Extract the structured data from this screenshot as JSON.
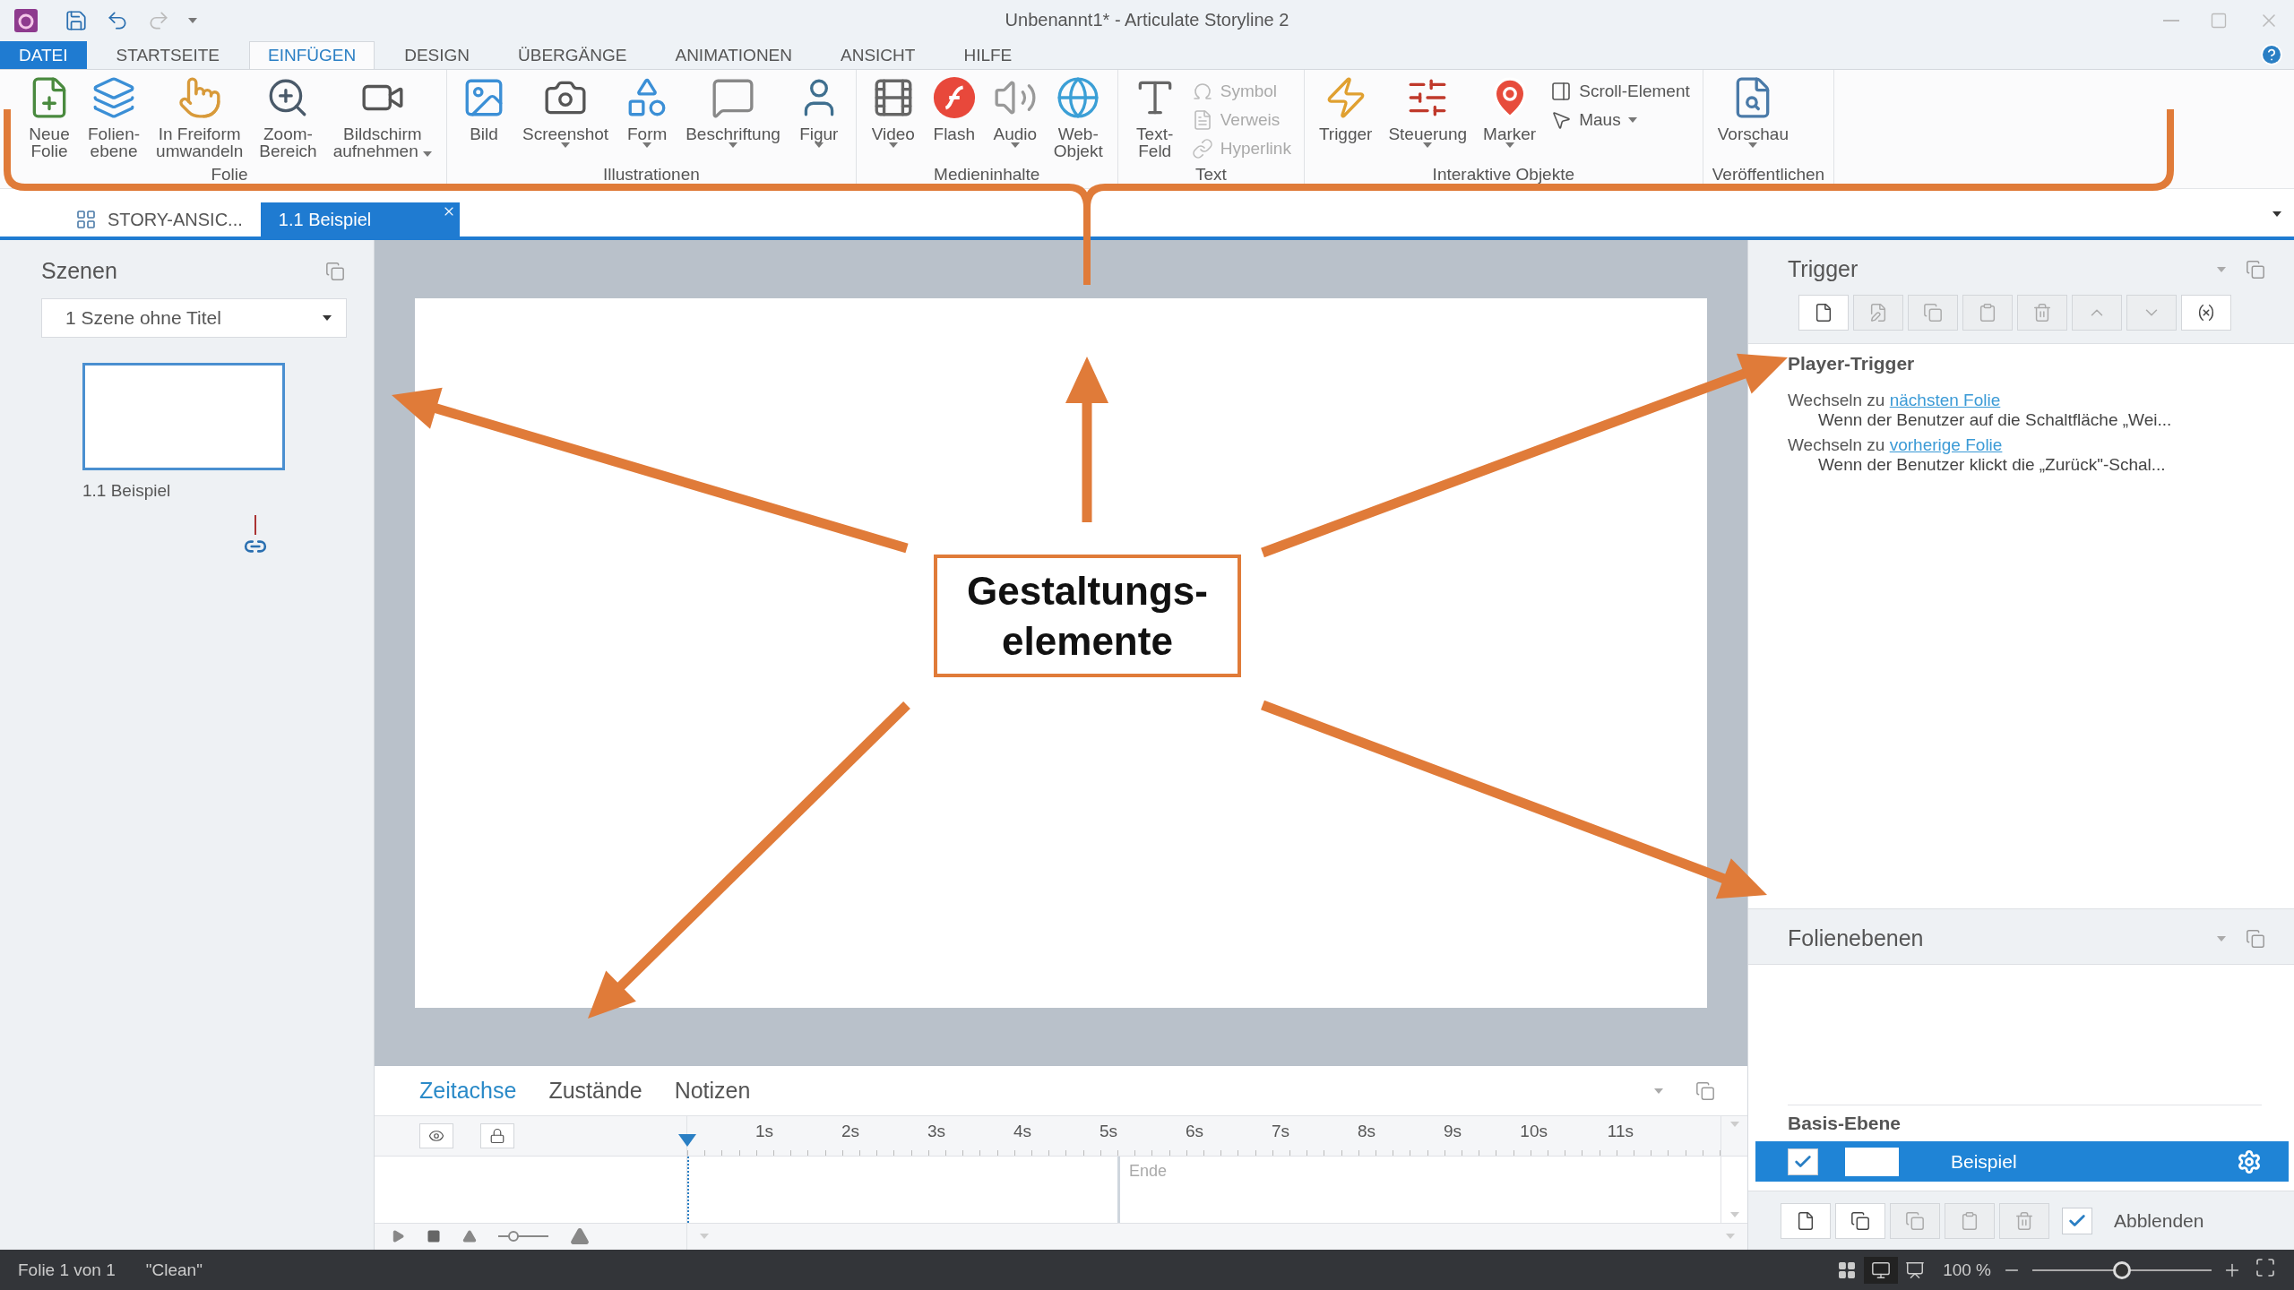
{
  "window": {
    "title": "Unbenannt1* - Articulate Storyline 2"
  },
  "ribbon_tabs": [
    {
      "label": "DATEI",
      "kind": "file",
      "selected": false
    },
    {
      "label": "STARTSEITE",
      "kind": "tab",
      "selected": false
    },
    {
      "label": "EINFÜGEN",
      "kind": "tab",
      "selected": true
    },
    {
      "label": "DESIGN",
      "kind": "tab",
      "selected": false
    },
    {
      "label": "ÜBERGÄNGE",
      "kind": "tab",
      "selected": false
    },
    {
      "label": "ANIMATIONEN",
      "kind": "tab",
      "selected": false
    },
    {
      "label": "ANSICHT",
      "kind": "tab",
      "selected": false
    },
    {
      "label": "HILFE",
      "kind": "tab",
      "selected": false
    }
  ],
  "ribbon_groups": [
    {
      "label": "Folie",
      "items": [
        {
          "kind": "large",
          "label": "Neue\nFolie",
          "dropdown": false
        },
        {
          "kind": "large",
          "label": "Folien-\nebene",
          "dropdown": false
        },
        {
          "kind": "large",
          "label": "In Freiform\numwandeln",
          "dropdown": false
        },
        {
          "kind": "large",
          "label": "Zoom-\nBereich",
          "dropdown": false
        },
        {
          "kind": "large",
          "label": "Bildschirm\naufnehmen",
          "dropdown": true,
          "inline_caret": true
        }
      ]
    },
    {
      "label": "Illustrationen",
      "items": [
        {
          "kind": "large",
          "label": "Bild",
          "dropdown": false
        },
        {
          "kind": "large",
          "label": "Screenshot",
          "dropdown": true
        },
        {
          "kind": "large",
          "label": "Form",
          "dropdown": true
        },
        {
          "kind": "large",
          "label": "Beschriftung",
          "dropdown": true
        },
        {
          "kind": "large",
          "label": "Figur",
          "dropdown": true
        }
      ]
    },
    {
      "label": "Medieninhalte",
      "items": [
        {
          "kind": "large",
          "label": "Video",
          "dropdown": true
        },
        {
          "kind": "large",
          "label": "Flash",
          "dropdown": false
        },
        {
          "kind": "large",
          "label": "Audio",
          "dropdown": true
        },
        {
          "kind": "large",
          "label": "Web-\nObjekt",
          "dropdown": false
        }
      ]
    },
    {
      "label": "Text",
      "items": [
        {
          "kind": "large",
          "label": "Text-\nFeld",
          "dropdown": false
        },
        {
          "kind": "small",
          "label": "Symbol",
          "disabled": true
        },
        {
          "kind": "small",
          "label": "Verweis",
          "disabled": true
        },
        {
          "kind": "small",
          "label": "Hyperlink",
          "disabled": true
        }
      ]
    },
    {
      "label": "Interaktive Objekte",
      "items": [
        {
          "kind": "large",
          "label": "Trigger",
          "dropdown": false
        },
        {
          "kind": "large",
          "label": "Steuerung",
          "dropdown": true
        },
        {
          "kind": "large",
          "label": "Marker",
          "dropdown": true
        },
        {
          "kind": "small",
          "label": "Scroll-Element",
          "disabled": false,
          "dropdown": false
        },
        {
          "kind": "small",
          "label": "Maus",
          "disabled": false,
          "dropdown": true
        }
      ]
    },
    {
      "label": "Veröffentlichen",
      "items": [
        {
          "kind": "large",
          "label": "Vorschau",
          "dropdown": true
        }
      ]
    }
  ],
  "doc_tabs": [
    {
      "label": "STORY-ANSIC...",
      "selected": false,
      "closable": false
    },
    {
      "label": "1.1 Beispiel",
      "selected": true,
      "closable": true
    }
  ],
  "scenes": {
    "title": "Szenen",
    "dropdown": "1 Szene ohne Titel",
    "slides": [
      {
        "label": "1.1 Beispiel",
        "selected": true
      }
    ]
  },
  "triggers": {
    "title": "Trigger",
    "toolbar": [
      {
        "disabled": false
      },
      {
        "disabled": true
      },
      {
        "disabled": true
      },
      {
        "disabled": true
      },
      {
        "disabled": true
      },
      {
        "disabled": true
      },
      {
        "disabled": true
      },
      {
        "disabled": false
      }
    ],
    "section": "Player-Trigger",
    "items": [
      {
        "action": "Wechseln zu",
        "target": "nächsten Folie",
        "condition": "Wenn der Benutzer auf die Schaltfläche „Wei..."
      },
      {
        "action": "Wechseln zu",
        "target": "vorherige Folie",
        "condition": "Wenn der Benutzer klickt die „Zurück\"-Schal..."
      }
    ]
  },
  "layers": {
    "title": "Folienebenen",
    "base_label": "Basis-Ebene",
    "items": [
      {
        "name": "Beispiel",
        "visible": true,
        "selected": true
      }
    ],
    "toolbar": [
      {
        "disabled": false
      },
      {
        "disabled": false
      },
      {
        "disabled": true
      },
      {
        "disabled": true
      },
      {
        "disabled": true
      }
    ],
    "dim": {
      "label": "Abblenden",
      "checked": true
    }
  },
  "timeline": {
    "tabs": [
      {
        "label": "Zeitachse",
        "selected": true
      },
      {
        "label": "Zustände",
        "selected": false
      },
      {
        "label": "Notizen",
        "selected": false
      }
    ],
    "ticks": [
      "1s",
      "2s",
      "3s",
      "4s",
      "5s",
      "6s",
      "7s",
      "8s",
      "9s",
      "10s",
      "11s"
    ],
    "end_label": "Ende",
    "zoom_slider": {
      "level": 0.3
    }
  },
  "status_bar": {
    "slide": "Folie 1 von 1",
    "theme": "\"Clean\"",
    "zoom": "100 %",
    "zoom_slider": {
      "level": 0.5
    }
  },
  "callout": {
    "text": "Gestaltungs-\nelemente"
  }
}
